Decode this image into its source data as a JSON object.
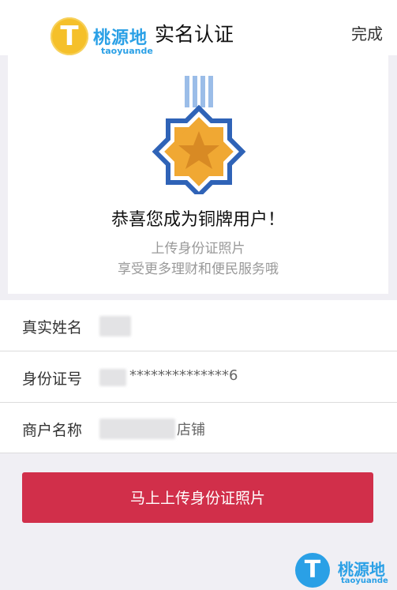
{
  "nav": {
    "title": "实名认证",
    "done": "完成"
  },
  "watermark": {
    "logo_letter": "T",
    "text": "桃源地",
    "sub": "taoyuande"
  },
  "card": {
    "medal_icon": "bronze-medal-icon",
    "congrats": "恭喜您成为铜牌用户！",
    "line1": "上传身份证照片",
    "line2": "享受更多理财和便民服务哦"
  },
  "form": {
    "name_label": "真实姓名",
    "id_label": "身份证号",
    "id_value": "**************6",
    "merchant_label": "商户名称",
    "merchant_value": "店铺"
  },
  "cta": {
    "label": "马上上传身份证照片"
  },
  "colors": {
    "accent": "#d12f4a",
    "medal_blue": "#2f63b7",
    "medal_gold": "#f0a833"
  }
}
